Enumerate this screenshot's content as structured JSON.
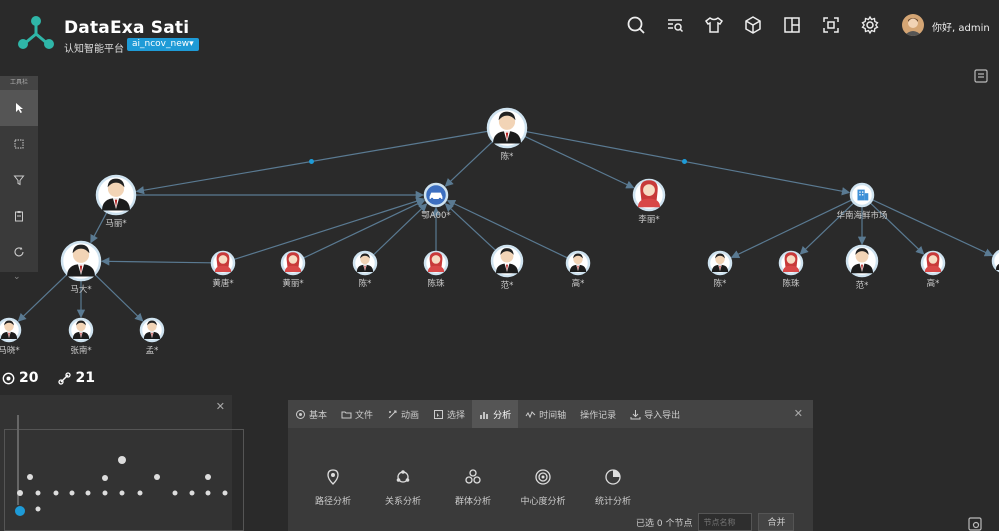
{
  "header": {
    "title": "DataExa Sati",
    "subtitle": "认知智能平台",
    "project": "ai_ncov_new▾",
    "greeting": "你好, admin",
    "toolbar_icons": [
      "search-icon",
      "list-search-icon",
      "tshirt-icon",
      "cube-icon",
      "layout-icon",
      "focus-icon",
      "gear-icon"
    ]
  },
  "left_toolbar": {
    "header": "工具栏",
    "tools": [
      "pointer-icon",
      "box-select-icon",
      "filter-icon",
      "clipboard-icon",
      "refresh-icon"
    ]
  },
  "graph": {
    "nodes": [
      {
        "label": "陈*",
        "kind": "man"
      },
      {
        "label": "马丽*",
        "kind": "man"
      },
      {
        "label": "鄂A00*",
        "kind": "car"
      },
      {
        "label": "李丽*",
        "kind": "woman"
      },
      {
        "label": "华南海鲜市场",
        "kind": "building"
      },
      {
        "label": "马大*",
        "kind": "man"
      },
      {
        "label": "黄唐*",
        "kind": "woman"
      },
      {
        "label": "黄丽*",
        "kind": "woman"
      },
      {
        "label": "陈*",
        "kind": "man"
      },
      {
        "label": "陈珠",
        "kind": "woman"
      },
      {
        "label": "范*",
        "kind": "man"
      },
      {
        "label": "高*",
        "kind": "man"
      },
      {
        "label": "陈*",
        "kind": "man"
      },
      {
        "label": "陈珠",
        "kind": "woman"
      },
      {
        "label": "范*",
        "kind": "man"
      },
      {
        "label": "高*",
        "kind": "woman"
      },
      {
        "label": "",
        "kind": "man"
      },
      {
        "label": "马晓*",
        "kind": "man"
      },
      {
        "label": "张南*",
        "kind": "man"
      },
      {
        "label": "孟*",
        "kind": "man"
      }
    ]
  },
  "stats": {
    "nodes": "20",
    "edges": "21"
  },
  "panel": {
    "tabs": [
      {
        "label": "基本",
        "icon": "basic-icon"
      },
      {
        "label": "文件",
        "icon": "folder-icon"
      },
      {
        "label": "动画",
        "icon": "animation-icon"
      },
      {
        "label": "选择",
        "icon": "select-icon"
      },
      {
        "label": "分析",
        "icon": "analysis-icon"
      },
      {
        "label": "时间轴",
        "icon": "timeline-icon"
      },
      {
        "label": "操作记录",
        "icon": ""
      },
      {
        "label": "导入导出",
        "icon": "import-export-icon"
      }
    ],
    "active_tab": "分析",
    "analysis": [
      {
        "label": "路径分析",
        "icon": "location-icon"
      },
      {
        "label": "关系分析",
        "icon": "relation-icon"
      },
      {
        "label": "群体分析",
        "icon": "group-icon"
      },
      {
        "label": "中心度分析",
        "icon": "target-icon"
      },
      {
        "label": "统计分析",
        "icon": "pie-chart-icon"
      }
    ],
    "selected_text": "已选 0 个节点",
    "node_name_placeholder": "节点名称",
    "merge_label": "合并"
  },
  "colors": {
    "accent": "#1e9bd7",
    "background": "#2a2a2a",
    "edge": "#5a7a92",
    "node_ring": "#cfe3f0"
  }
}
